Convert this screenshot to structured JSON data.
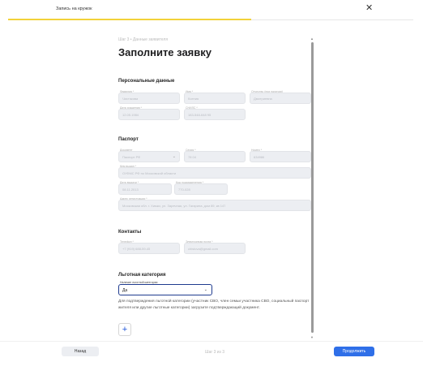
{
  "header": {
    "title": "Запись на кружок",
    "close_icon": "close-icon",
    "progress_fraction": 0.6
  },
  "form": {
    "step_label": "Шаг 3 • Данные заявителя",
    "heading": "Заполните заявку",
    "personal": {
      "title": "Персональные данные",
      "surname_label": "Фамилия *",
      "surname_value": "Чистякова",
      "name_label": "Имя *",
      "name_value": "Ксения",
      "patronymic_label": "Отчество (при наличии)",
      "patronymic_value": "Дмитриевна",
      "birthdate_label": "Дата рождения *",
      "birthdate_value": "12.05.1984",
      "snils_label": "СНИЛС *",
      "snils_value": "183-548-648 95"
    },
    "passport": {
      "title": "Паспорт",
      "doc_label": "Документ",
      "doc_value": "Паспорт РФ",
      "series_label": "Серия *",
      "series_value": "78 04",
      "number_label": "Номер *",
      "number_value": "634986",
      "issued_label": "Кем выдан *",
      "issued_value": "ОУФМС РФ по Московской области",
      "issue_date_label": "Дата выдачи *",
      "issue_date_value": "08.11.2013",
      "code_label": "Код подразделения *",
      "code_value": "770-028",
      "address_label": "Адрес регистрации *",
      "address_value": "Московская обл. г. Химки, ул. Заречная, ул. Гагарина, дом 89, кв 147"
    },
    "contacts": {
      "title": "Контакты",
      "phone_label": "Телефон *",
      "phone_value": "+7 (919) 688-59-45",
      "email_label": "Электронная почта *",
      "email_value": "chistova@gmail.com"
    },
    "benefit": {
      "title": "Льготная категория",
      "select_label": "Наличие льготной категории",
      "select_value": "Да",
      "note": "Для подтверждения льготной категории (участник СВО, член семьи участника СВО, социальный паспорт жителя или другие льготные категории) загрузите подтверждающий документ.",
      "add_symbol": "+"
    }
  },
  "footer": {
    "back_label": "Назад",
    "step_count": "Шаг 3 из 3",
    "next_label": "Продолжить"
  }
}
